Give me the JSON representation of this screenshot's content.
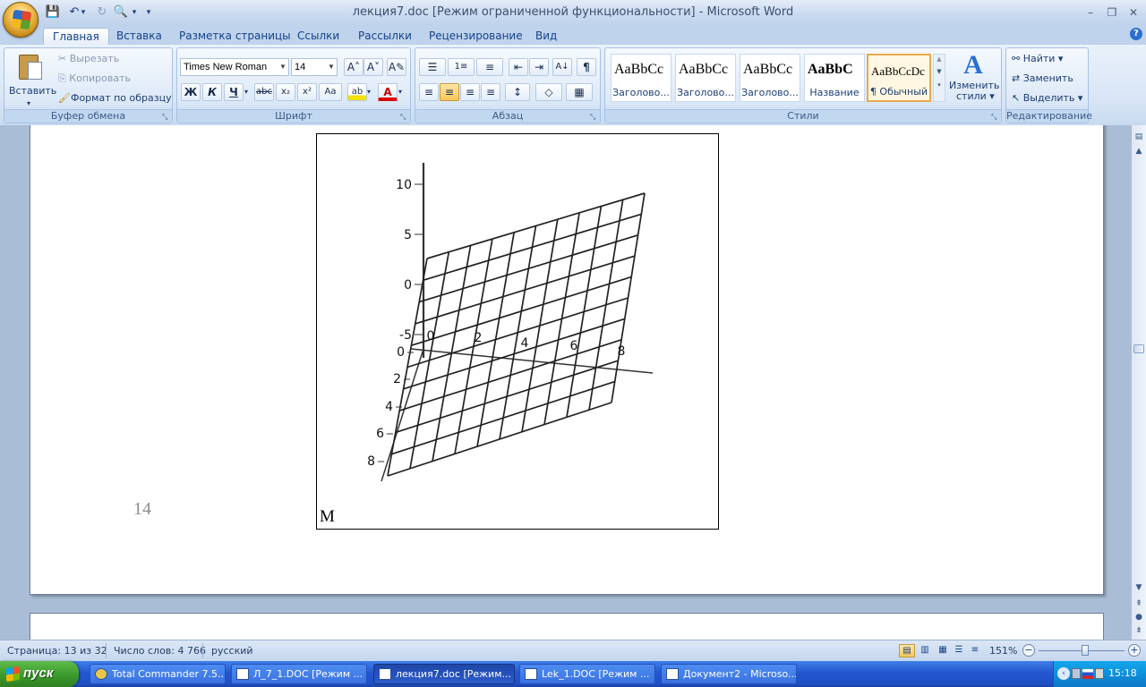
{
  "window": {
    "title": "лекция7.doc [Режим ограниченной функциональности] - Microsoft Word",
    "min": "–",
    "max": "❐",
    "close": "✕"
  },
  "qat": {
    "save_icon": "💾",
    "undo_icon": "↶",
    "redo_icon": "↻",
    "preview_icon": "🔍",
    "more_icon": "▾"
  },
  "tabs": [
    "Главная",
    "Вставка",
    "Разметка страницы",
    "Ссылки",
    "Рассылки",
    "Рецензирование",
    "Вид"
  ],
  "help_icon": "?",
  "clipboard": {
    "paste": "Вставить",
    "cut": "Вырезать",
    "copy": "Копировать",
    "format_painter": "Формат по образцу",
    "label": "Буфер обмена"
  },
  "font": {
    "name": "Times New Roman",
    "size": "14",
    "label": "Шрифт",
    "grow": "A˄",
    "shrink": "A˅",
    "clear": "A✎",
    "bold": "Ж",
    "italic": "К",
    "underline": "Ч",
    "strike": "abc",
    "sub": "x₂",
    "sup": "x²",
    "case": "Aa",
    "highlight": "ab",
    "color": "A"
  },
  "paragraph": {
    "label": "Абзац",
    "bullets": "☰",
    "numbering": "1≡",
    "multilevel": "≡",
    "dec_indent": "⇤",
    "inc_indent": "⇥",
    "sort": "A↓",
    "pilcrow": "¶",
    "left": "≡",
    "center": "≡",
    "right": "≡",
    "justify": "≡",
    "spacing": "↕",
    "shading": "◇",
    "borders": "▦"
  },
  "styles": {
    "label": "Стили",
    "items": [
      {
        "sample": "AaBbCc",
        "name": "Заголово..."
      },
      {
        "sample": "AaBbCc",
        "name": "Заголово..."
      },
      {
        "sample": "AaBbCc",
        "name": "Заголово..."
      },
      {
        "sample": "AaBbC",
        "name": "Название"
      },
      {
        "sample": "AaBbCcDc",
        "name": "¶ Обычный"
      }
    ],
    "change_styles_line1": "Изменить",
    "change_styles_line2": "стили ▾",
    "change_icon": "A"
  },
  "editing": {
    "label": "Редактирование",
    "find": "Найти ▾",
    "replace": "Заменить",
    "select": "Выделить ▾"
  },
  "document": {
    "page_number": "14",
    "figure_caption": "M"
  },
  "chart_data": {
    "type": "surface3d",
    "z_ticks": [
      "10",
      "5",
      "0",
      "-5"
    ],
    "x_ticks": [
      "0",
      "2",
      "4",
      "6",
      "8"
    ],
    "y_ticks": [
      "0",
      "2",
      "4",
      "6",
      "8"
    ],
    "grid_rows": 10,
    "grid_cols": 10
  },
  "status": {
    "page": "Страница: 13 из 32",
    "words": "Число слов: 4 766",
    "lang": "русский",
    "zoom": "151%",
    "zoom_out": "−",
    "zoom_in": "+"
  },
  "taskbar": {
    "start": "пуск",
    "items": [
      "Total Commander 7.5...",
      "Л_7_1.DOC [Режим ...",
      "лекция7.doc [Режим...",
      "Lek_1.DOC [Режим ...",
      "Документ2 - Microso..."
    ],
    "clock": "15:18"
  }
}
